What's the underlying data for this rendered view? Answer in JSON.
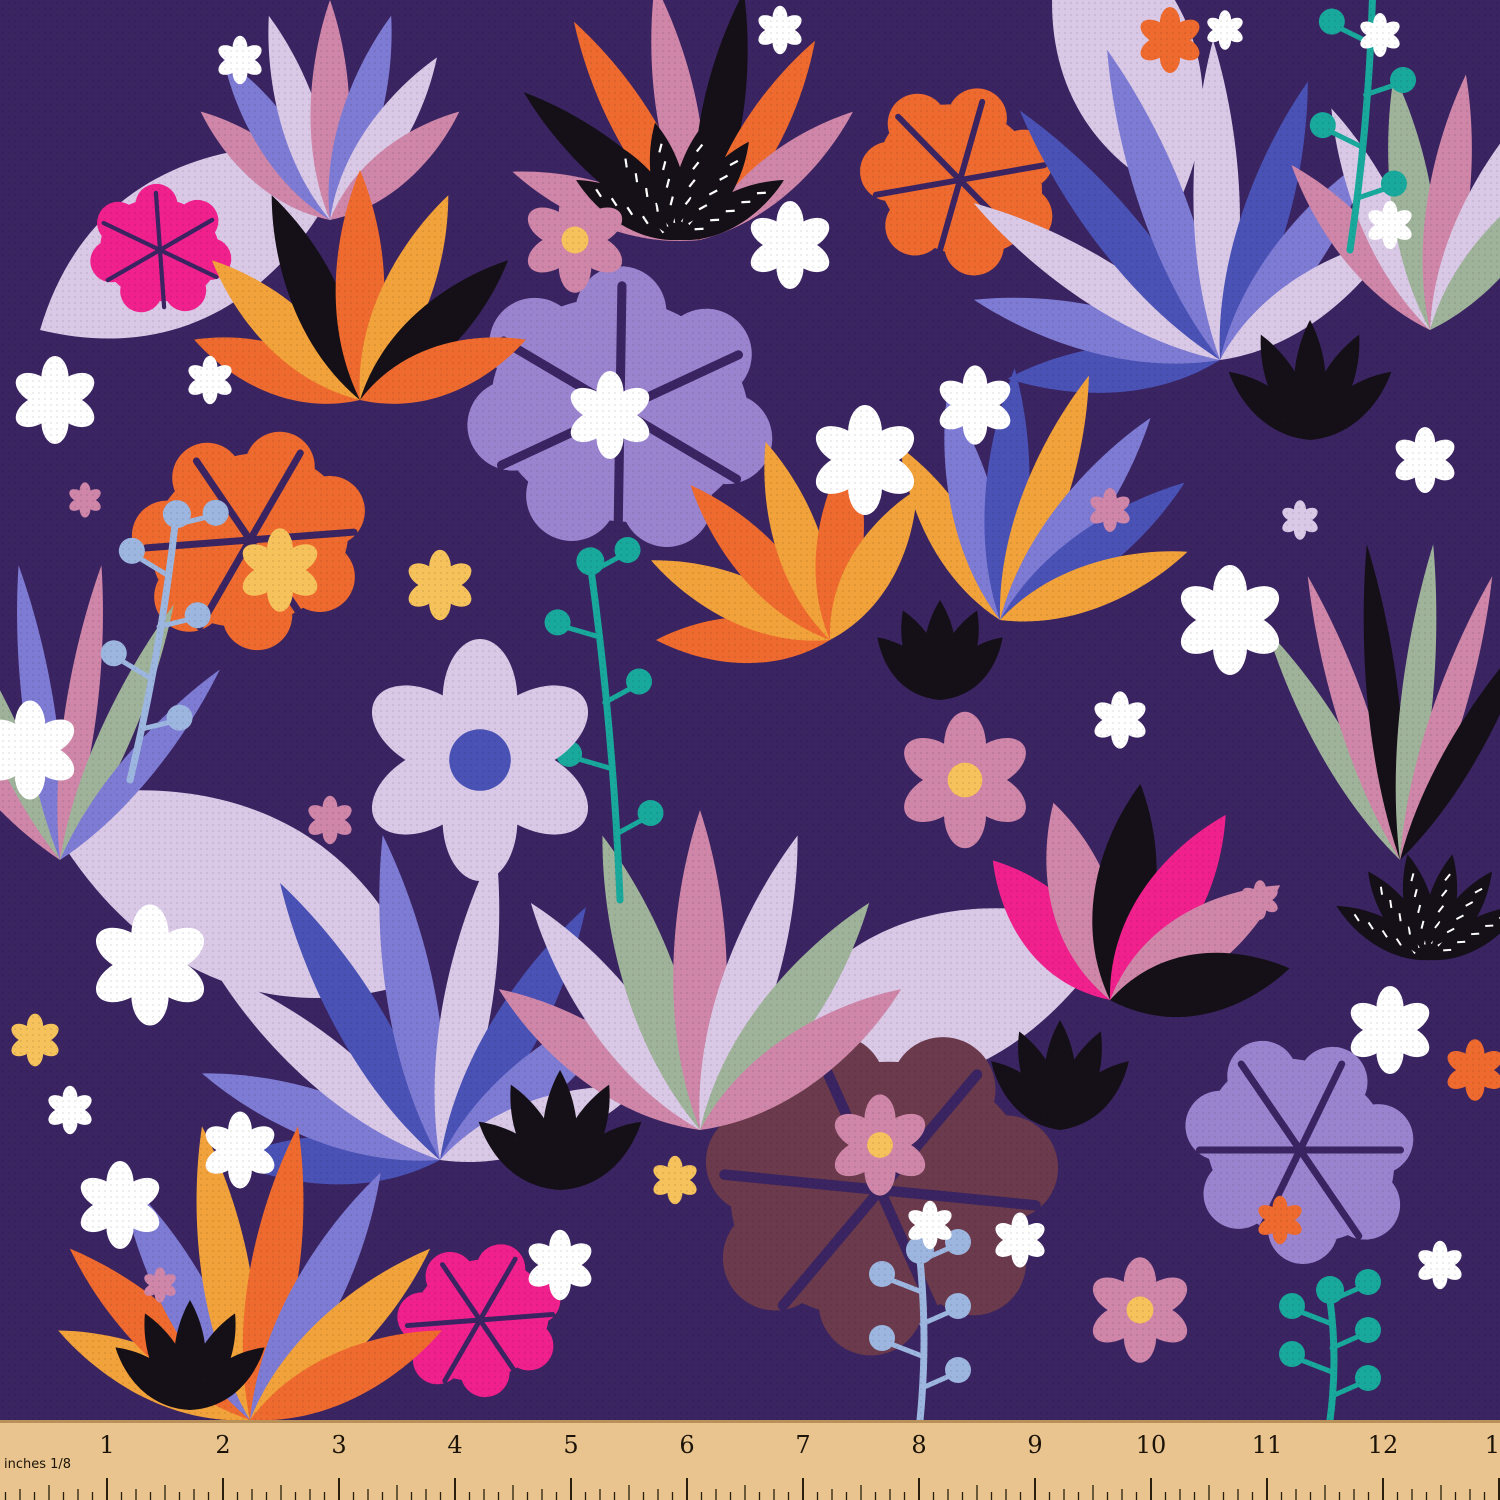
{
  "pattern": {
    "background": "#3a2461",
    "palette": {
      "lavender": "#9b84cf",
      "pale-lilac": "#d9c8e6",
      "pink": "#cf86a8",
      "orange": "#ee6a2e",
      "amber": "#f2a23a",
      "blue": "#4a52b6",
      "periwinkle": "#7e7bd4",
      "teal": "#19a89c",
      "magenta": "#f0208c",
      "black": "#151018",
      "white": "#ffffff",
      "sage": "#9fb39a",
      "plum": "#6b3a4c",
      "yellow": "#f6c25b"
    }
  },
  "ruler": {
    "label": "inches 1/8",
    "numbers": [
      "1",
      "2",
      "3",
      "4",
      "5",
      "6",
      "7",
      "8",
      "9",
      "10",
      "11",
      "12",
      "1"
    ],
    "background": "#e9c48e"
  }
}
